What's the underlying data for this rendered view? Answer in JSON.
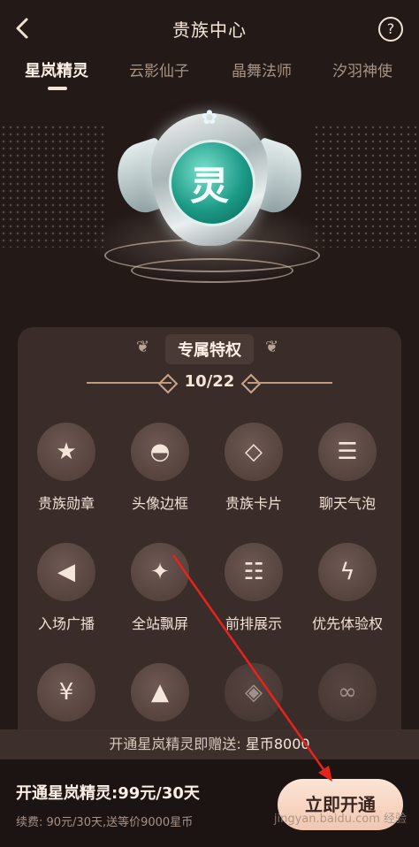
{
  "header": {
    "title": "贵族中心",
    "help_icon": "question-circle-icon",
    "back_icon": "chevron-left-icon"
  },
  "tabs": [
    {
      "label": "星岚精灵",
      "active": true
    },
    {
      "label": "云影仙子",
      "active": false
    },
    {
      "label": "晶舞法师",
      "active": false
    },
    {
      "label": "汐羽神使",
      "active": false
    }
  ],
  "hero": {
    "badge_char": "灵"
  },
  "privileges": {
    "title": "专属特权",
    "count": "10/22",
    "items": [
      {
        "label": "贵族勋章",
        "icon": "star-badge-icon"
      },
      {
        "label": "头像边框",
        "icon": "avatar-frame-icon"
      },
      {
        "label": "贵族卡片",
        "icon": "diamond-card-icon"
      },
      {
        "label": "聊天气泡",
        "icon": "chat-bubble-icon"
      },
      {
        "label": "入场广播",
        "icon": "megaphone-icon"
      },
      {
        "label": "全站飘屏",
        "icon": "magic-wand-icon"
      },
      {
        "label": "前排展示",
        "icon": "list-icon"
      },
      {
        "label": "优先体验权",
        "icon": "lightning-icon"
      },
      {
        "label": "",
        "icon": "yen-ticket-icon"
      },
      {
        "label": "",
        "icon": "rocket-icon"
      },
      {
        "label": "",
        "icon": "gift-box-icon"
      },
      {
        "label": "",
        "icon": "mask-icon"
      }
    ]
  },
  "promo": {
    "text": "开通星岚精灵即赠送:",
    "highlight": "星币8000"
  },
  "bottom": {
    "offer": "开通星岚精灵:99元/30天",
    "renew": "续费: 90元/30天,送等价9000星币",
    "cta": "立即开通",
    "watermark": "jingyan.baidu.com 经验"
  },
  "colors": {
    "background": "#231a18",
    "panel": "#3a2d29",
    "cta": "#f1c7b1",
    "annotation_arrow": "#e8231b"
  }
}
